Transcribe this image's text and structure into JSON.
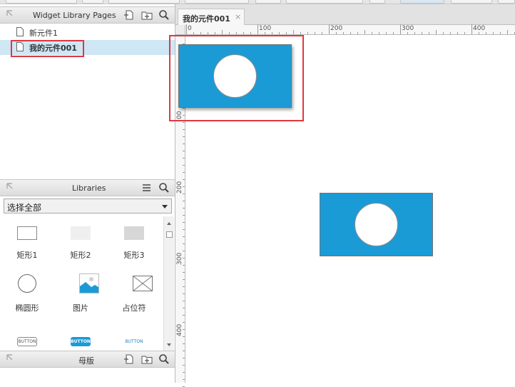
{
  "pages_panel": {
    "title": "Widget Library Pages",
    "icons": [
      "add-page-icon",
      "add-folder-icon",
      "search-icon"
    ],
    "pages": [
      {
        "label": "新元件1",
        "selected": false
      },
      {
        "label": "我的元件001",
        "selected": true
      }
    ]
  },
  "libraries_panel": {
    "title": "Libraries",
    "select_value": "选择全部",
    "items": [
      {
        "label": "矩形1",
        "icon": "rectangle-outline-icon"
      },
      {
        "label": "矩形2",
        "icon": "rectangle-light-icon"
      },
      {
        "label": "矩形3",
        "icon": "rectangle-gray-icon"
      },
      {
        "label": "椭圆形",
        "icon": "ellipse-icon"
      },
      {
        "label": "图片",
        "icon": "image-icon"
      },
      {
        "label": "占位符",
        "icon": "placeholder-icon"
      },
      {
        "label": "BUTTON",
        "icon": "button-outline-icon"
      },
      {
        "label": "BUTTON",
        "icon": "button-primary-icon"
      },
      {
        "label": "BUTTON",
        "icon": "button-link-icon"
      }
    ]
  },
  "masters_panel": {
    "title": "母版"
  },
  "editor": {
    "tab_label": "我的元件001",
    "tab_close": "×",
    "h_ruler_labels": [
      "0",
      "100",
      "200",
      "300",
      "400"
    ],
    "v_ruler_labels": [
      "00",
      "200",
      "300",
      "400"
    ]
  },
  "colors": {
    "widget_fill": "#1b9bd6",
    "selection_red": "#e0383e",
    "selected_row": "#cfe6f5"
  }
}
